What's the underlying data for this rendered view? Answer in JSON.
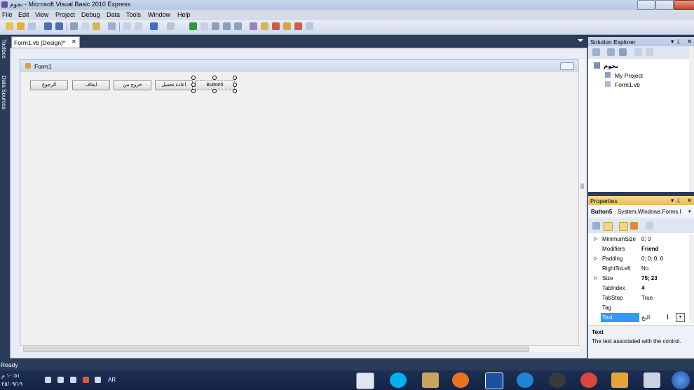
{
  "window": {
    "title": "نجوم - Microsoft Visual Basic 2010 Express"
  },
  "menu": [
    "File",
    "Edit",
    "View",
    "Project",
    "Debug",
    "Data",
    "Tools",
    "Window",
    "Help"
  ],
  "left_strip": {
    "toolbox": "Toolbox",
    "data_sources": "Data Sources"
  },
  "doc_tab": {
    "label": "Form1.vb [Design]*",
    "close": "✕"
  },
  "form": {
    "title": "Form1",
    "buttons": [
      "الرجوع",
      "ايقاف",
      "خروج من",
      "اعادة تحميل",
      "Button5"
    ]
  },
  "solution_explorer": {
    "title": "Solution Explorer",
    "items": [
      "نجوم",
      "My Project",
      "Form1.vb"
    ]
  },
  "properties": {
    "title": "Properties",
    "object": "Button5",
    "type": "System.Windows.Forms.I",
    "rows": [
      {
        "name": "MinimumSize",
        "value": "0; 0"
      },
      {
        "name": "Modifiers",
        "value": "Friend"
      },
      {
        "name": "Padding",
        "value": "0; 0; 0; 0"
      },
      {
        "name": "RightToLeft",
        "value": "No"
      },
      {
        "name": "Size",
        "value": "75; 23"
      },
      {
        "name": "TabIndex",
        "value": "4"
      },
      {
        "name": "TabStop",
        "value": "True"
      },
      {
        "name": "Tag",
        "value": ""
      },
      {
        "name": "Text",
        "value": "البح"
      }
    ],
    "desc_title": "Text",
    "desc_text": "The text associated with the control."
  },
  "status": {
    "text": "Ready"
  },
  "taskbar": {
    "time": "١٠:٥١ م",
    "date": "٢٥/٠٩/١٩",
    "lang": "AR"
  },
  "colors": {
    "accent": "#3399ff",
    "selected_row": "#3399ff"
  }
}
